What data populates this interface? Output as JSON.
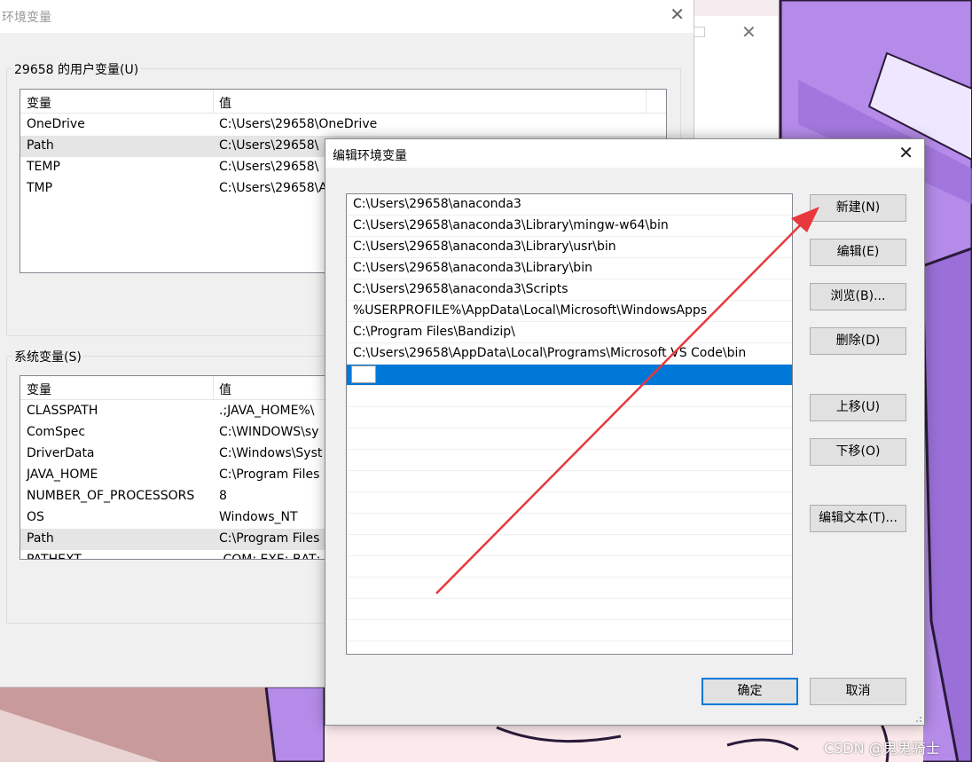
{
  "env_dialog": {
    "title": "环境变量",
    "user_group_title": "29658 的用户变量(U)",
    "system_group_title": "系统变量(S)",
    "col_variable": "变量",
    "col_value": "值",
    "user_vars": [
      {
        "name": "OneDrive",
        "value": "C:\\Users\\29658\\OneDrive"
      },
      {
        "name": "Path",
        "value": "C:\\Users\\29658\\"
      },
      {
        "name": "TEMP",
        "value": "C:\\Users\\29658\\"
      },
      {
        "name": "TMP",
        "value": "C:\\Users\\29658\\A"
      }
    ],
    "system_vars": [
      {
        "name": "CLASSPATH",
        "value": ".;JAVA_HOME%\\"
      },
      {
        "name": "ComSpec",
        "value": "C:\\WINDOWS\\sy"
      },
      {
        "name": "DriverData",
        "value": "C:\\Windows\\Syst"
      },
      {
        "name": "JAVA_HOME",
        "value": "C:\\Program Files"
      },
      {
        "name": "NUMBER_OF_PROCESSORS",
        "value": "8"
      },
      {
        "name": "OS",
        "value": "Windows_NT"
      },
      {
        "name": "Path",
        "value": "C:\\Program Files"
      },
      {
        "name": "PATHEXT",
        "value": ".COM;.EXE;.BAT;"
      }
    ]
  },
  "edit_dialog": {
    "title": "编辑环境变量",
    "paths": [
      "C:\\Users\\29658\\anaconda3",
      "C:\\Users\\29658\\anaconda3\\Library\\mingw-w64\\bin",
      "C:\\Users\\29658\\anaconda3\\Library\\usr\\bin",
      "C:\\Users\\29658\\anaconda3\\Library\\bin",
      "C:\\Users\\29658\\anaconda3\\Scripts",
      "%USERPROFILE%\\AppData\\Local\\Microsoft\\WindowsApps",
      "C:\\Program Files\\Bandizip\\",
      "C:\\Users\\29658\\AppData\\Local\\Programs\\Microsoft VS Code\\bin"
    ],
    "buttons": {
      "new": "新建(N)",
      "edit": "编辑(E)",
      "browse": "浏览(B)...",
      "delete": "删除(D)",
      "move_up": "上移(U)",
      "move_down": "下移(O)",
      "edit_text": "编辑文本(T)...",
      "ok": "确定",
      "cancel": "取消"
    }
  },
  "watermark": "CSDN @鬼鬼骑士",
  "colors": {
    "selection": "#0078d7",
    "arrow": "#e8383d",
    "hair": "#b48be8"
  }
}
